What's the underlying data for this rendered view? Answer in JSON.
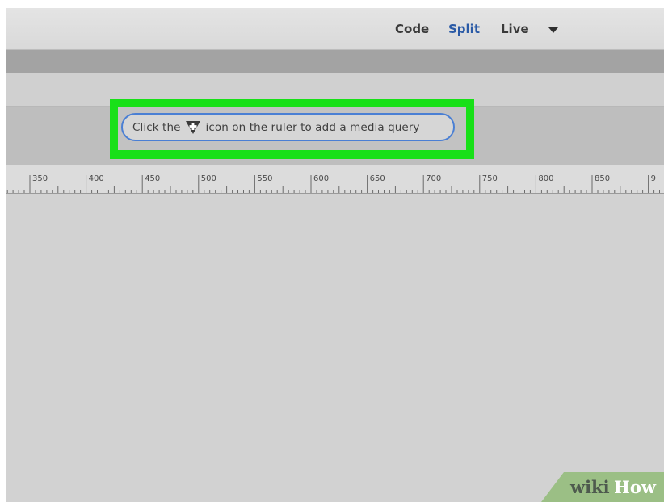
{
  "toolbar": {
    "views": [
      "Code",
      "Split",
      "Live"
    ],
    "active_view": "Split",
    "active_color": "#2a5aa6",
    "live_menu_icon": "caret-down-icon"
  },
  "media_query_bar": {
    "message_before_icon": "Click the",
    "message_after_icon": "icon on the ruler to add a media query",
    "icon": "add-media-query-icon",
    "pill_border_color": "#4a7fd4"
  },
  "highlight": {
    "color": "#18e018"
  },
  "ruler": {
    "tick_labels": [
      "350",
      "400",
      "450",
      "500",
      "550",
      "600",
      "650",
      "700",
      "750",
      "800",
      "850",
      "9"
    ]
  },
  "watermark": {
    "part1": "wiki",
    "part2": "How",
    "color": "#9bbf85"
  }
}
